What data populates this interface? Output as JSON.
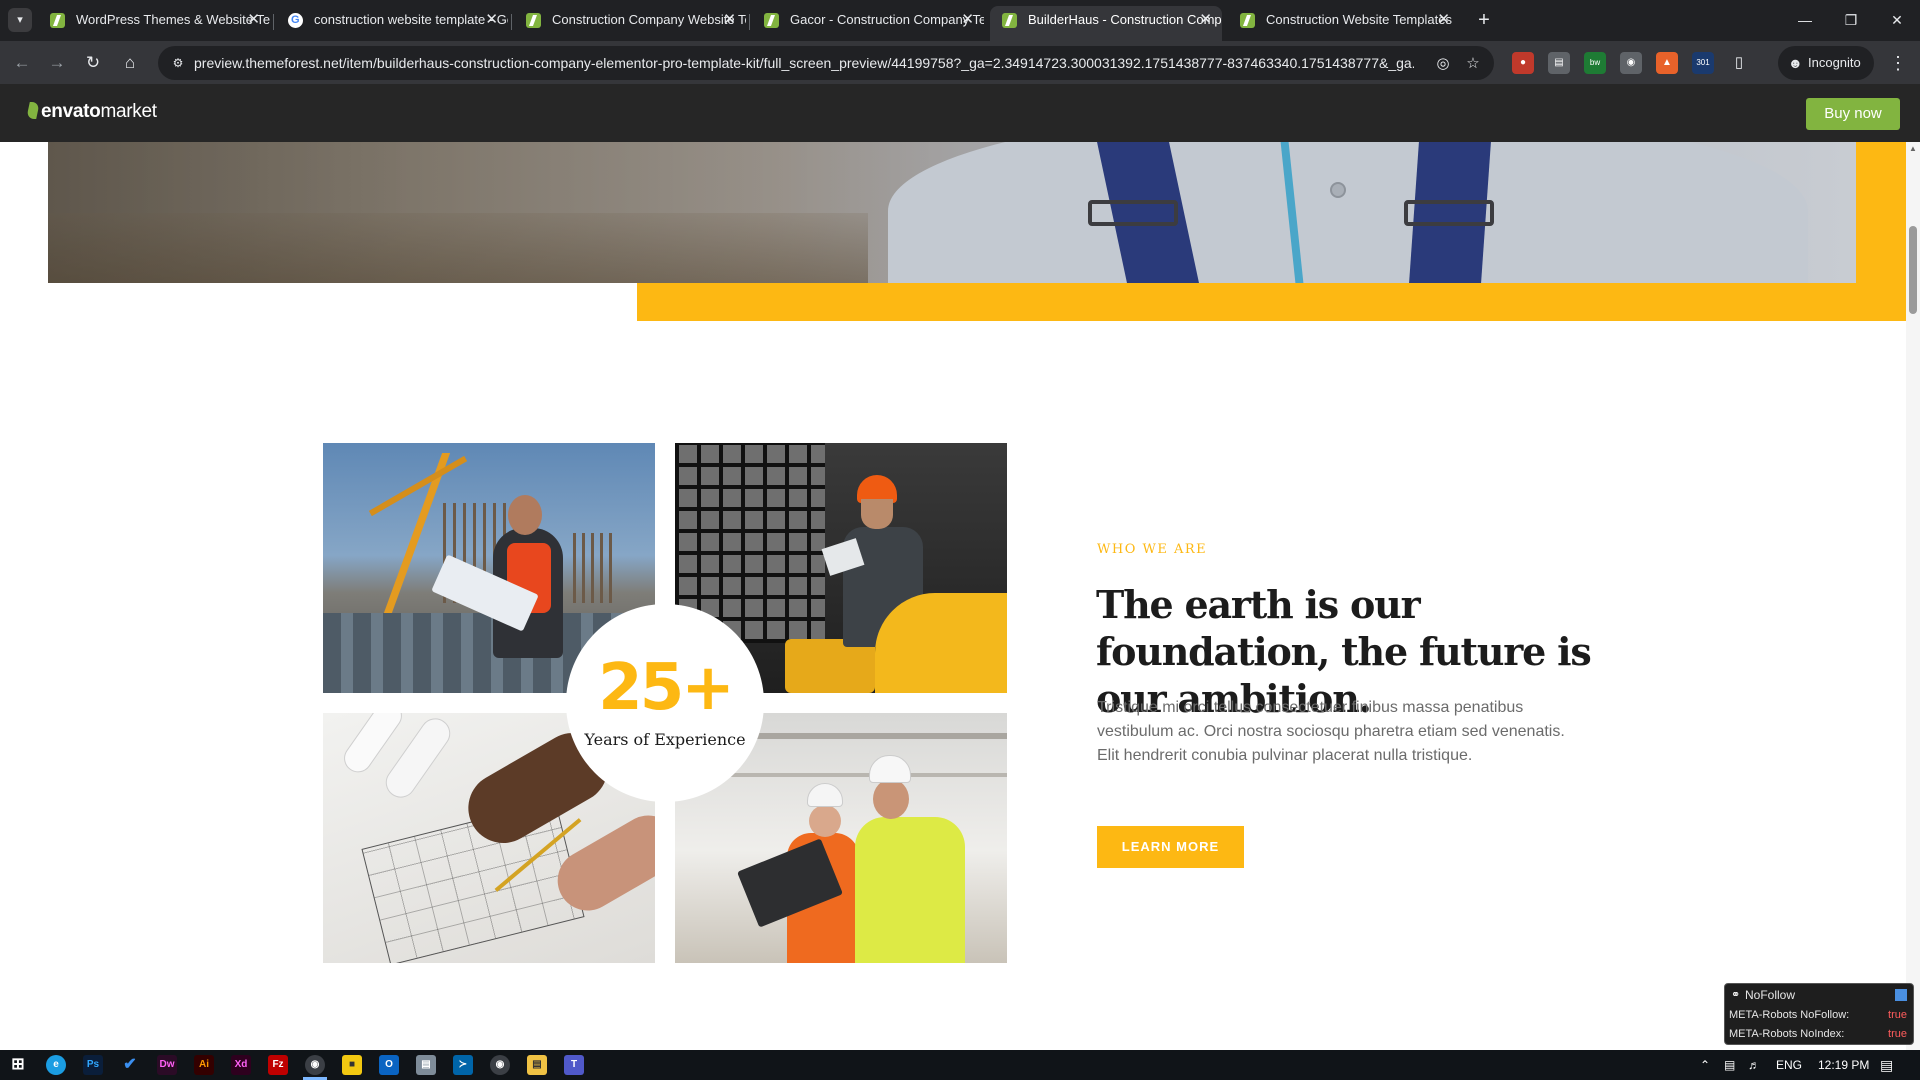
{
  "browser": {
    "tabs": [
      {
        "title": "WordPress Themes & Website Templates",
        "icon": "envato-icon",
        "active": false
      },
      {
        "title": "construction website template - Google Search",
        "icon": "google-icon",
        "active": false
      },
      {
        "title": "Construction Company Website Template",
        "icon": "envato-icon",
        "active": false
      },
      {
        "title": "Gacor - Construction Company Template Kit",
        "icon": "envato-icon",
        "active": false
      },
      {
        "title": "BuilderHaus - Construction Company Elementor Pro Template Kit",
        "icon": "envato-icon",
        "active": true
      },
      {
        "title": "Construction Website Templates",
        "icon": "envato-icon",
        "active": false
      }
    ],
    "url": "preview.themeforest.net/item/builderhaus-construction-company-elementor-pro-template-kit/full_screen_preview/44199758?_ga=2.34914723.300031392.1751438777-837463340.1751438777&_ga...",
    "profile_label": "Incognito",
    "extension_badge": "301"
  },
  "envato": {
    "logo_bold": "envato",
    "logo_light": "market",
    "buy_label": "Buy now"
  },
  "about": {
    "badge_number": "25+",
    "badge_label": "Years of Experience",
    "eyebrow": "WHO WE ARE",
    "headline": "The earth is our foundation, the future is our ambition.",
    "body": "Tristique mi orci tellus consectetuer finibus massa penatibus vestibulum ac. Orci nostra sociosqu pharetra etiam sed venenatis. Elit hendrerit conubia pulvinar placerat nulla tristique.",
    "cta": "LEARN MORE"
  },
  "nofollow": {
    "title": "NoFollow",
    "rows": [
      {
        "label": "META-Robots NoFollow:",
        "value": "true"
      },
      {
        "label": "META-Robots NoIndex:",
        "value": "true"
      }
    ]
  },
  "taskbar": {
    "language": "ENG",
    "time": "12:19 PM"
  },
  "colors": {
    "accent_yellow": "#fdb813",
    "envato_green": "#82b440",
    "heading": "#1c1c1c"
  }
}
